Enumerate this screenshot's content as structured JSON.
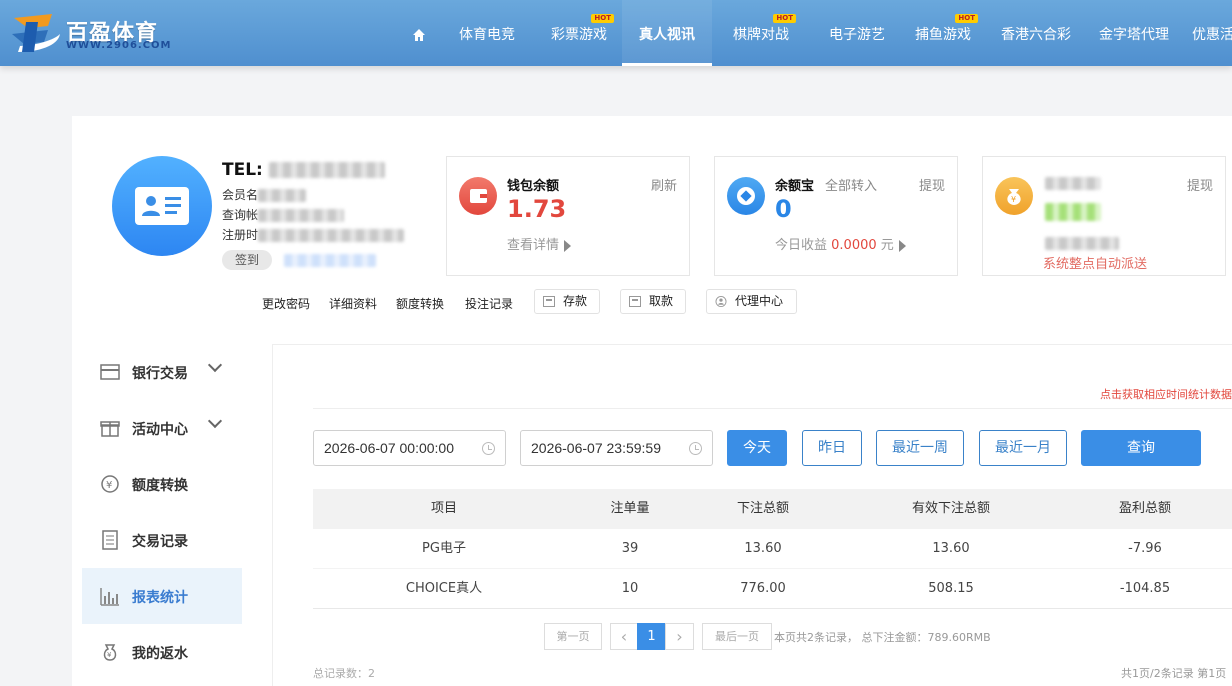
{
  "logo": {
    "name": "百盈体育",
    "url": "WWW.2906.COM"
  },
  "nav": {
    "items": [
      {
        "label": "",
        "icon": "home-icon",
        "hot": false
      },
      {
        "label": "体育电竞",
        "hot": false
      },
      {
        "label": "彩票游戏",
        "hot": true
      },
      {
        "label": "真人视讯",
        "hot": false,
        "active": true
      },
      {
        "label": "棋牌对战",
        "hot": true
      },
      {
        "label": "电子游艺",
        "hot": false
      },
      {
        "label": "捕鱼游戏",
        "hot": true
      },
      {
        "label": "香港六合彩",
        "hot": false
      },
      {
        "label": "金字塔代理",
        "hot": false
      },
      {
        "label": "优惠活",
        "hot": false
      }
    ],
    "hot_label": "HOT"
  },
  "profile": {
    "tel_label": "TEL:",
    "member_label": "会员名",
    "query_label": "查询帐",
    "register_label": "注册时",
    "sign_label": "签到"
  },
  "wallet": {
    "title": "钱包余额",
    "value": "1.73",
    "refresh": "刷新",
    "detail": "查看详情"
  },
  "yeb": {
    "title": "余额宝",
    "value": "0",
    "transfer_all": "全部转入",
    "withdraw": "提现",
    "today_label": "今日收益",
    "today_value": "0.0000",
    "unit": "元"
  },
  "third": {
    "withdraw": "提现",
    "auto_note": "系统整点自动派送"
  },
  "actions": {
    "change_pwd": "更改密码",
    "detail_info": "详细资料",
    "quota_transfer": "额度转换",
    "bet_record": "投注记录",
    "deposit": "存款",
    "withdraw": "取款",
    "agent_center": "代理中心"
  },
  "sidebar": {
    "items": [
      {
        "label": "银行交易",
        "icon": "bank-card-icon",
        "expandable": true
      },
      {
        "label": "活动中心",
        "icon": "gift-icon",
        "expandable": true
      },
      {
        "label": "额度转换",
        "icon": "yen-exchange-icon",
        "expandable": false
      },
      {
        "label": "交易记录",
        "icon": "document-icon",
        "expandable": false
      },
      {
        "label": "报表统计",
        "icon": "bar-chart-icon",
        "expandable": false,
        "active": true
      },
      {
        "label": "我的返水",
        "icon": "money-bag-icon",
        "expandable": false
      }
    ]
  },
  "report": {
    "hint": "点击获取相应时间统计数据",
    "start_date": "2026-06-07 00:00:00",
    "end_date": "2026-06-07 23:59:59",
    "buttons": {
      "today": "今天",
      "yesterday": "昨日",
      "week": "最近一周",
      "month": "最近一月",
      "query": "查询"
    },
    "columns": [
      "项目",
      "注单量",
      "下注总额",
      "有效下注总额",
      "盈利总额"
    ],
    "rows": [
      [
        "PG电子",
        "39",
        "13.60",
        "13.60",
        "-7.96"
      ],
      [
        "CHOICE真人",
        "10",
        "776.00",
        "508.15",
        "-104.85"
      ]
    ],
    "pager": {
      "first": "第一页",
      "current": "1",
      "last": "最后一页",
      "prev": "‹",
      "next": "›"
    },
    "page_summary": "本页共2条记录， 总下注金额：789.60RMB",
    "total_label": "总记录数：2",
    "page_info": "共1页/2条记录 第1页"
  },
  "colors": {
    "accent": "#3a8ee6",
    "header": "#5d9bd6",
    "wallet_red": "#e2473d",
    "active_bg": "#eaf3fb"
  }
}
